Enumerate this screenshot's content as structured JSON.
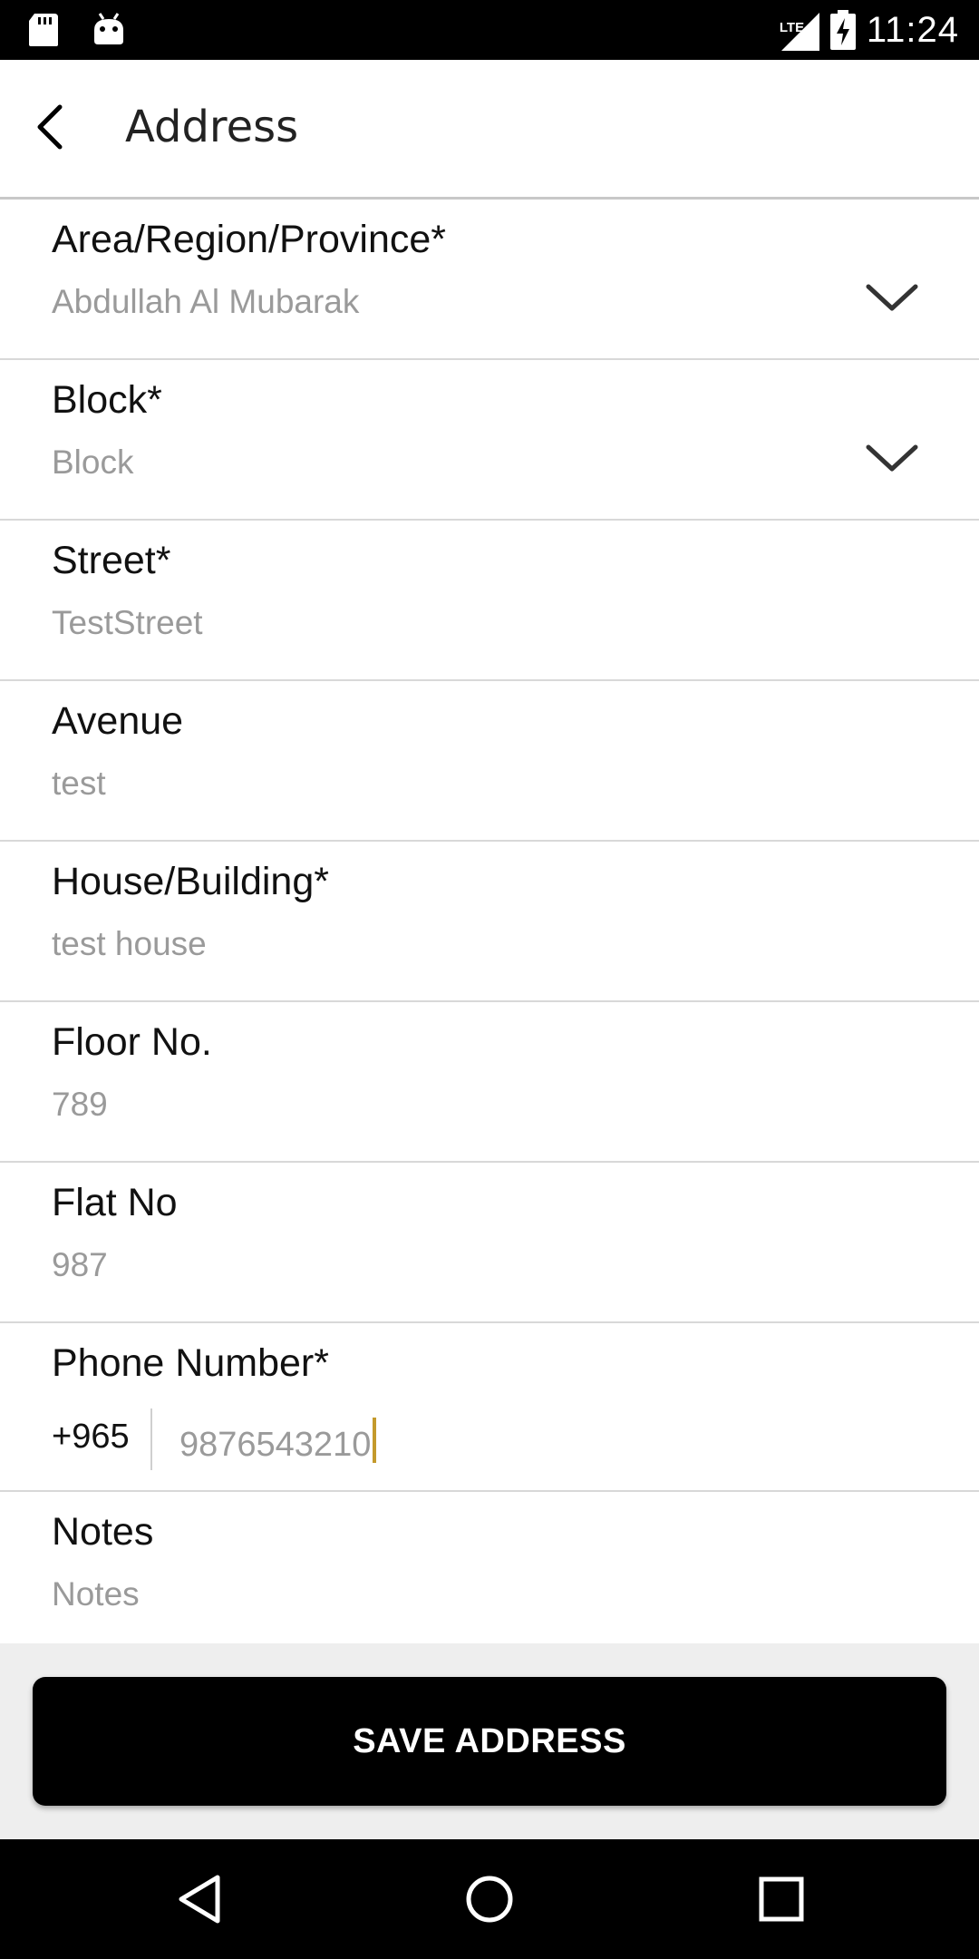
{
  "status_bar": {
    "time": "11:24",
    "network": "LTE",
    "icons": [
      "sd-card-icon",
      "android-debug-icon",
      "signal-icon",
      "battery-charging-icon"
    ]
  },
  "app_bar": {
    "title": "Address",
    "back_icon": "chevron-left-icon"
  },
  "form": {
    "area": {
      "label": "Area/Region/Province*",
      "value": "Abdullah Al Mubarak",
      "icon": "chevron-down-icon"
    },
    "block": {
      "label": "Block*",
      "placeholder": "Block",
      "icon": "chevron-down-icon"
    },
    "street": {
      "label": "Street*",
      "value": "TestStreet"
    },
    "avenue": {
      "label": "Avenue",
      "value": "test"
    },
    "house": {
      "label": "House/Building*",
      "value": "test house"
    },
    "floor": {
      "label": "Floor No.",
      "value": "789"
    },
    "flat": {
      "label": "Flat No",
      "value": "987"
    },
    "phone": {
      "label": "Phone Number*",
      "prefix": "+965",
      "value": "9876543210"
    },
    "notes": {
      "label": "Notes",
      "placeholder": "Notes"
    }
  },
  "actions": {
    "save_label": "SAVE ADDRESS"
  },
  "nav_bar": {
    "icons": [
      "back-triangle-icon",
      "home-circle-icon",
      "recents-square-icon"
    ]
  },
  "colors": {
    "status_bar_bg": "#000000",
    "button_bg": "#000000",
    "caret": "#c49a2c",
    "placeholder": "#9a9a9a"
  }
}
